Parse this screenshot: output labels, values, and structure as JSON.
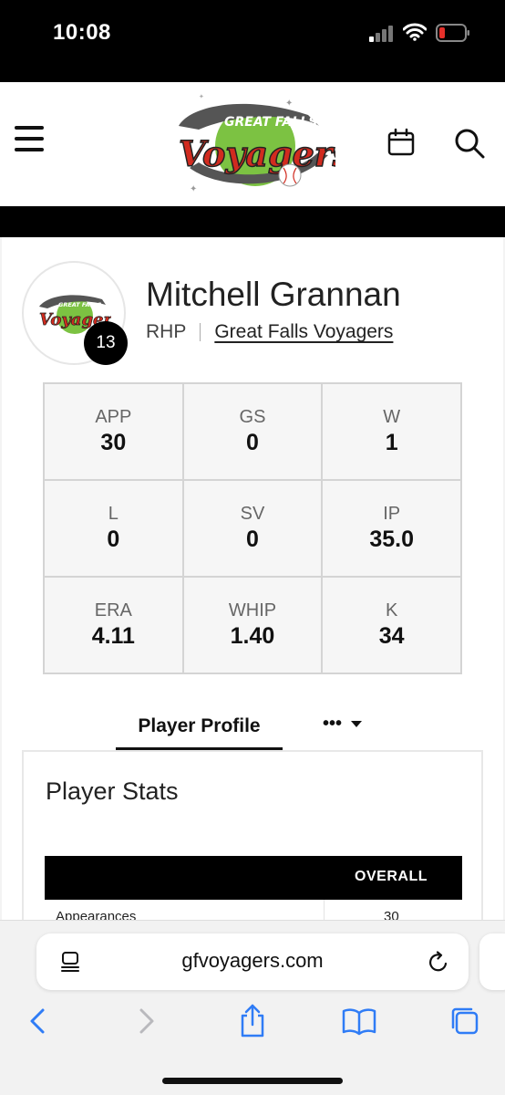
{
  "status_bar": {
    "time": "10:08"
  },
  "header": {
    "logo_alt": "Great Falls Voyagers"
  },
  "player": {
    "name": "Mitchell Grannan",
    "position": "RHP",
    "team": "Great Falls Voyagers",
    "number": "13"
  },
  "stats": [
    {
      "label": "APP",
      "value": "30"
    },
    {
      "label": "GS",
      "value": "0"
    },
    {
      "label": "W",
      "value": "1"
    },
    {
      "label": "L",
      "value": "0"
    },
    {
      "label": "SV",
      "value": "0"
    },
    {
      "label": "IP",
      "value": "35.0"
    },
    {
      "label": "ERA",
      "value": "4.11"
    },
    {
      "label": "WHIP",
      "value": "1.40"
    },
    {
      "label": "K",
      "value": "34"
    }
  ],
  "tabs": {
    "active": "Player Profile",
    "more": "•••"
  },
  "panel": {
    "title": "Player Stats",
    "table_header": "OVERALL",
    "rows": [
      {
        "label": "Appearances",
        "value": "30"
      }
    ]
  },
  "browser": {
    "url": "gfvoyagers.com"
  },
  "colors": {
    "brand_red": "#d12b1f",
    "brand_green": "#7cc242",
    "dark": "#000000"
  }
}
